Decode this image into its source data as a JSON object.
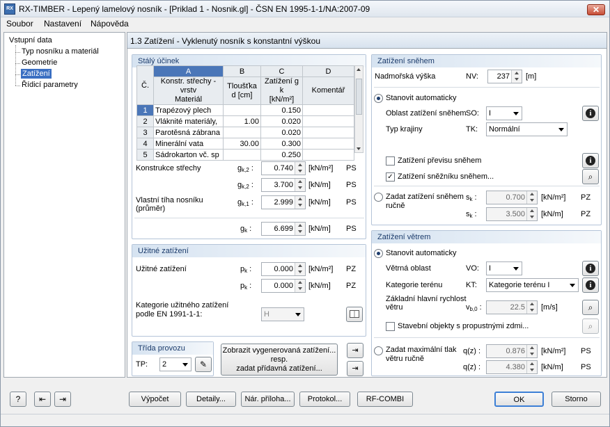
{
  "window": {
    "title": "RX-TIMBER - Lepený lamelový nosník - [Priklad 1 - Nosnik.gl] - ČSN EN 1995-1-1/NA:2007-09",
    "app_icon": "RX"
  },
  "menu": [
    "Soubor",
    "Nastavení",
    "Nápověda"
  ],
  "tree": {
    "root": "Vstupní data",
    "items": [
      "Typ nosníku a materiál",
      "Geometrie",
      "Zatížení",
      "Řídicí parametry"
    ],
    "selected_index": 2
  },
  "section_title": "1.3 Zatížení  -  Vyklenutý nosník s konstantní výškou",
  "stale": {
    "title": "Stálý účinek",
    "col_letters": [
      "A",
      "B",
      "C",
      "D"
    ],
    "col_no": "Č.",
    "col_headers": [
      "Konstr. střechy - vrstv\nMateriál",
      "Tloušťka\nd [cm]",
      "Zatížení g k\n[kN/m²]",
      "Komentář"
    ],
    "rows": [
      {
        "no": "1",
        "material": "Trapézový plech",
        "d": "",
        "g": "0.150",
        "c": ""
      },
      {
        "no": "2",
        "material": "Vláknité materiály,",
        "d": "1.00",
        "g": "0.020",
        "c": ""
      },
      {
        "no": "3",
        "material": "Parotěsná zábrana",
        "d": "",
        "g": "0.020",
        "c": ""
      },
      {
        "no": "4",
        "material": "Minerální vata",
        "d": "30.00",
        "g": "0.300",
        "c": ""
      },
      {
        "no": "5",
        "material": "Sádrokarton vč. sp",
        "d": "",
        "g": "0.250",
        "c": ""
      }
    ],
    "konstrukce_label": "Konstrukce střechy",
    "gk2_a": {
      "sym": "g",
      "sub": "k,2",
      "value": "0.740",
      "unit": "[kN/m²]",
      "code": "PS"
    },
    "gk2_b": {
      "sym": "g",
      "sub": "k,2",
      "value": "3.700",
      "unit": "[kN/m]",
      "code": "PS"
    },
    "vlastni_label": "Vlastní tíha nosníku\n(průměr)",
    "gk1": {
      "sym": "g",
      "sub": "k,1",
      "value": "2.999",
      "unit": "[kN/m]",
      "code": "PS"
    },
    "gk": {
      "sym": "g",
      "sub": "k",
      "value": "6.699",
      "unit": "[kN/m]",
      "code": "PS"
    }
  },
  "uzitne": {
    "title": "Užitné zatížení",
    "label": "Užitné zatížení",
    "pk_a": {
      "sym": "p",
      "sub": "k",
      "value": "0.000",
      "unit": "[kN/m²]",
      "code": "PZ"
    },
    "pk_b": {
      "sym": "p",
      "sub": "k",
      "value": "0.000",
      "unit": "[kN/m]",
      "code": "PZ"
    },
    "kategorie_label": "Kategorie užitného zatížení\npodle EN 1991-1-1:",
    "kategorie_value": "H"
  },
  "trida": {
    "title": "Třída provozu",
    "label": "TP:",
    "value": "2"
  },
  "zobrazit_button": "Zobrazit vygenerovaná zatížení...\nresp.\nzadat přídavná zatížení...",
  "snih": {
    "title": "Zatížení sněhem",
    "nadmorska_label": "Nadmořská výška",
    "nv_sym": "NV:",
    "nv_value": "237",
    "nv_unit": "[m]",
    "auto_label": "Stanovit automaticky",
    "oblast_label": "Oblast zatížení sněhem",
    "oblast_sym": "SO:",
    "oblast_value": "I",
    "krajina_label": "Typ krajiny",
    "krajina_sym": "TK:",
    "krajina_value": "Normální",
    "previs_label": "Zatížení převisu sněhem",
    "previs_checked": false,
    "snehnik_label": "Zatížení sněžníku sněhem...",
    "snehnik_checked": true,
    "rucne_label": "Zadat zatížení sněhem\nručně",
    "sk_a": {
      "sym": "s",
      "sub": "k",
      "value": "0.700",
      "unit": "[kN/m²]",
      "code": "PZ"
    },
    "sk_b": {
      "sym": "s",
      "sub": "k",
      "value": "3.500",
      "unit": "[kN/m]",
      "code": "PZ"
    }
  },
  "vitr": {
    "title": "Zatížení větrem",
    "auto_label": "Stanovit automaticky",
    "oblast_label": "Větrná oblast",
    "oblast_sym": "VO:",
    "oblast_value": "I",
    "teren_label": "Kategorie terénu",
    "teren_sym": "KT:",
    "teren_value": "Kategorie terénu I",
    "rychlost_label": "Základní hlavní rychlost\nvětru",
    "vb_sym": "v",
    "vb_sub": "b,0",
    "vb_value": "22.5",
    "vb_unit": "[m/s]",
    "stavebni_label": "Stavební objekty s propustnými zdmi...",
    "stavebni_checked": false,
    "tlak_label": "Zadat maximální tlak\nvětru ručně",
    "qz_a": {
      "sym": "q(z)",
      "value": "0.876",
      "unit": "[kN/m²]",
      "code": "PS"
    },
    "qz_b": {
      "sym": "q(z)",
      "value": "4.380",
      "unit": "[kN/m]",
      "code": "PS"
    }
  },
  "buttons": {
    "vypocet": "Výpočet",
    "detaily": "Detaily...",
    "priloha": "Nár. příloha...",
    "protokol": "Protokol...",
    "rfcombi": "RF-COMBI",
    "ok": "OK",
    "storno": "Storno"
  },
  "colors": {
    "accent": "#4a76b8",
    "panel_title": "#1a3a6a",
    "close": "#c74d36"
  }
}
